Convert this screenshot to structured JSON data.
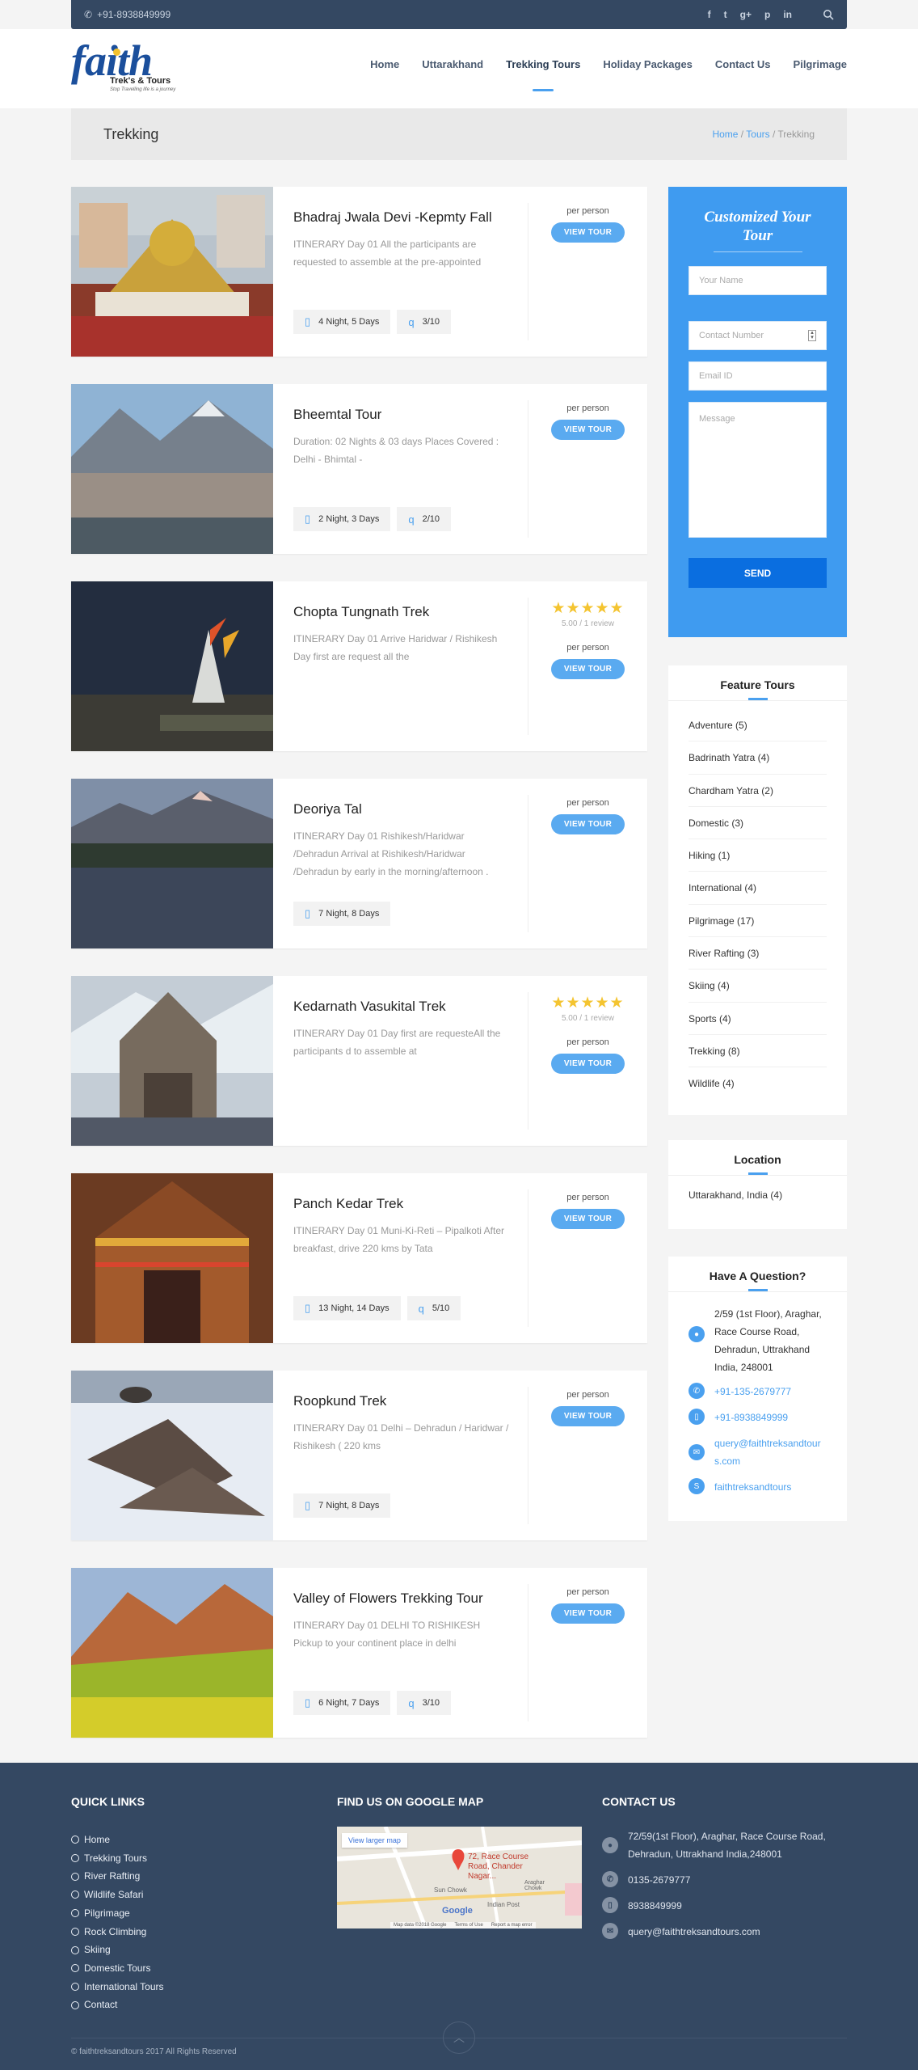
{
  "topbar": {
    "phone": "+91-8938849999",
    "socials": [
      "f",
      "t",
      "g+",
      "p",
      "in"
    ]
  },
  "brand": {
    "logo_word": "faith",
    "logo_sub": "Trek's & Tours",
    "logo_tag": "Stop Travelling life is a journey"
  },
  "nav": {
    "items": [
      "Home",
      "Uttarakhand",
      "Trekking Tours",
      "Holiday Packages",
      "Contact Us",
      "Pilgrimage"
    ],
    "active": "Trekking Tours"
  },
  "banner": {
    "title": "Trekking",
    "crumb_home": "Home",
    "crumb_tours": "Tours",
    "crumb_current": "Trekking",
    "sep": "/"
  },
  "tours": [
    {
      "title": "Bhadraj Jwala Devi -Kepmty Fall",
      "desc": "ITINERARY Day 01 All the participants are requested to assemble at the pre-appointed",
      "duration": "4 Night, 5 Days",
      "rating": "3/10",
      "per": "per person",
      "btn": "VIEW TOUR"
    },
    {
      "title": "Bheemtal Tour",
      "desc": "Duration: 02 Nights & 03 days Places Covered : Delhi - Bhimtal -",
      "duration": "2 Night, 3 Days",
      "rating": "2/10",
      "per": "per person",
      "btn": "VIEW TOUR"
    },
    {
      "title": "Chopta Tungnath Trek",
      "desc": "ITINERARY Day 01 Arrive Haridwar / Rishikesh Day first are request all the",
      "stars": "★★★★★",
      "review": "5.00 / 1 review",
      "per": "per person",
      "btn": "VIEW TOUR"
    },
    {
      "title": "Deoriya Tal",
      "desc": "ITINERARY Day 01 Rishikesh/Haridwar /Dehradun Arrival at Rishikesh/Haridwar /Dehradun by early in the morning/afternoon .",
      "duration": "7 Night, 8 Days",
      "per": "per person",
      "btn": "VIEW TOUR"
    },
    {
      "title": "Kedarnath Vasukital Trek",
      "desc": "ITINERARY Day 01 Day first are requesteAll the participants d to assemble at",
      "stars": "★★★★★",
      "review": "5.00 / 1 review",
      "per": "per person",
      "btn": "VIEW TOUR"
    },
    {
      "title": "Panch Kedar Trek",
      "desc": "ITINERARY Day 01 Muni-Ki-Reti – Pipalkoti After breakfast, drive 220 kms by Tata",
      "duration": "13 Night, 14 Days",
      "rating": "5/10",
      "per": "per person",
      "btn": "VIEW TOUR"
    },
    {
      "title": "Roopkund Trek",
      "desc": "ITINERARY Day 01 Delhi – Dehradun / Haridwar / Rishikesh ( 220 kms",
      "duration": "7 Night, 8 Days",
      "per": "per person",
      "btn": "VIEW TOUR"
    },
    {
      "title": "Valley of Flowers Trekking Tour",
      "desc": "ITINERARY Day 01 DELHI TO RISHIKESH Pickup to your continent place in delhi",
      "duration": "6 Night, 7 Days",
      "rating": "3/10",
      "per": "per person",
      "btn": "VIEW TOUR"
    }
  ],
  "form": {
    "title": "Customized Your Tour",
    "name_ph": "Your Name",
    "contact_ph": "Contact Number",
    "email_ph": "Email ID",
    "message_ph": "Message",
    "send": "SEND"
  },
  "feature": {
    "title": "Feature Tours",
    "items": [
      "Adventure (5)",
      "Badrinath Yatra (4)",
      "Chardham Yatra (2)",
      "Domestic (3)",
      "Hiking (1)",
      "International (4)",
      "Pilgrimage (17)",
      "River Rafting (3)",
      "Skiing (4)",
      "Sports (4)",
      "Trekking (8)",
      "Wildlife (4)"
    ]
  },
  "location": {
    "title": "Location",
    "item": "Uttarakhand, India (4)"
  },
  "question": {
    "title": "Have A Question?",
    "address": "2/59 (1st Floor), Araghar, Race Course Road, Dehradun, Uttrakhand India, 248001",
    "phone": "+91-135-2679777",
    "mobile": "+91-8938849999",
    "email": "query@faithtreksandtours.com",
    "skype": "faithtreksandtours"
  },
  "footer": {
    "quick_title": "QUICK LINKS",
    "quick_links": [
      "Home",
      "Trekking Tours",
      "River Rafting",
      "Wildlife Safari",
      "Pilgrimage",
      "Rock Climbing",
      "Skiing",
      "Domestic Tours",
      "International Tours",
      "Contact"
    ],
    "map_title": "FIND US ON GOOGLE MAP",
    "map_link": "View larger map",
    "map_pin": "72, Race Course Road, Chander Nagar...",
    "map_labels": [
      "Sun Chowk",
      "Indian Post",
      "Araghar Chowk",
      "Google",
      "Map data ©2018 Google",
      "Terms of Use",
      "Report a map error"
    ],
    "contact_title": "CONTACT US",
    "address": "72/59(1st Floor), Araghar, Race Course Road, Dehradun, Uttrakhand India,248001",
    "phone": "0135-2679777",
    "mobile": "8938849999",
    "email": "query@faithtreksandtours.com",
    "copyright": "© faithtreksandtours 2017 All Rights Reserved"
  },
  "colors": {
    "accent": "#4aa0ef",
    "navy": "#344862",
    "form_bg": "#3f9bf0",
    "send_btn": "#0a6ee0",
    "star": "#f4c430"
  }
}
